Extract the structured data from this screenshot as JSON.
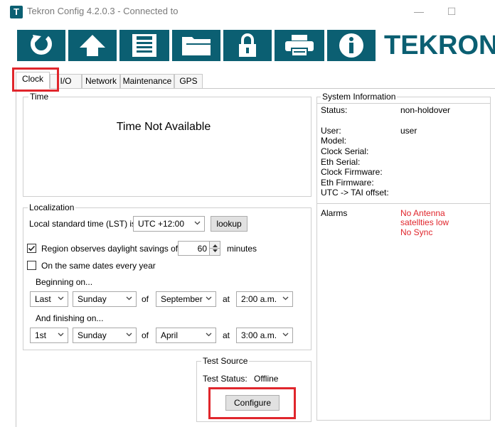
{
  "window": {
    "app_icon_letter": "T",
    "title": "Tekron Config 4.2.0.3 - Connected to",
    "minimize_glyph": "—",
    "maximize_glyph": "☐"
  },
  "toolbar": {
    "logo_text": "TEKRON",
    "icons": [
      "refresh-icon",
      "upload-icon",
      "save-icon",
      "folder-icon",
      "lock-icon",
      "print-icon",
      "info-icon"
    ],
    "accent_color": "#0b5f72"
  },
  "tabs": [
    {
      "label": "Clock"
    },
    {
      "label": "I/O"
    },
    {
      "label": "Network"
    },
    {
      "label": "Maintenance"
    },
    {
      "label": "GPS"
    }
  ],
  "time_group": {
    "label": "Time",
    "message": "Time Not Available"
  },
  "localization": {
    "label": "Localization",
    "lst_label": "Local standard time (LST) is",
    "lst_value": "UTC +12:00",
    "lookup_button": "lookup",
    "dst_label": "Region observes daylight savings of",
    "dst_checked": true,
    "dst_minutes": "60",
    "minutes_label": "minutes",
    "same_dates_label": "On the same dates every year",
    "same_dates_checked": false,
    "beginning_label": "Beginning on...",
    "begin": {
      "week": "Last",
      "day": "Sunday",
      "of": "of",
      "month": "September",
      "at": "at",
      "time": "2:00 a.m."
    },
    "finishing_label": "And finishing on...",
    "finish": {
      "week": "1st",
      "day": "Sunday",
      "of": "of",
      "month": "April",
      "at": "at",
      "time": "3:00 a.m."
    }
  },
  "test_source": {
    "label": "Test Source",
    "status_label": "Test Status:",
    "status_value": "Offline",
    "configure_button": "Configure"
  },
  "system_info": {
    "label": "System Information",
    "status_label": "Status:",
    "status_value": "non-holdover",
    "user_label": "User:",
    "user_value": "user",
    "model_label": "Model:",
    "clock_serial_label": "Clock Serial:",
    "eth_serial_label": "Eth Serial:",
    "clock_firmware_label": "Clock Firmware:",
    "eth_firmware_label": "Eth Firmware:",
    "utc_tai_label": "UTC -> TAI offset:",
    "alarms_label": "Alarms",
    "alarms": [
      "No Antenna",
      "satellties low",
      "No Sync"
    ],
    "alarm_color": "#e0262c"
  }
}
